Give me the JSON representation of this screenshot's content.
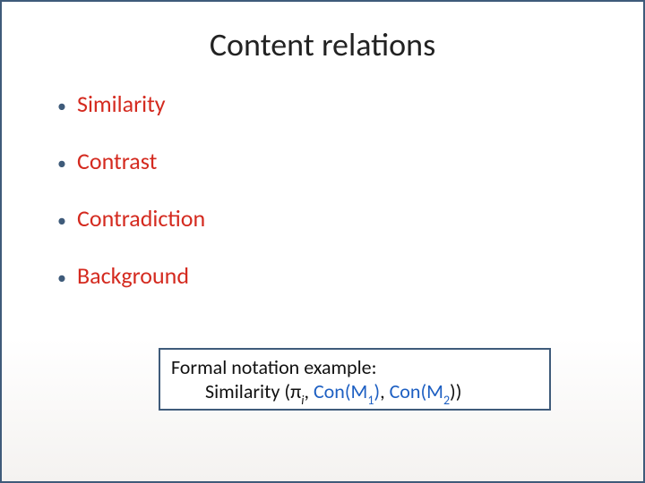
{
  "title": "Content relations",
  "bullets": {
    "b0": "Similarity",
    "b1": "Contrast",
    "b2": "Contradiction",
    "b3": "Background"
  },
  "formal": {
    "heading": "Formal notation example:",
    "fn": "Similarity",
    "open": " (",
    "pi": "π",
    "pi_sub": "i",
    "comma1": ", ",
    "con1": "Con(M",
    "con1_sub": "1",
    "close1": ")",
    "comma2": ", ",
    "con2": "Con(M",
    "con2_sub": "2",
    "close2": "))"
  }
}
